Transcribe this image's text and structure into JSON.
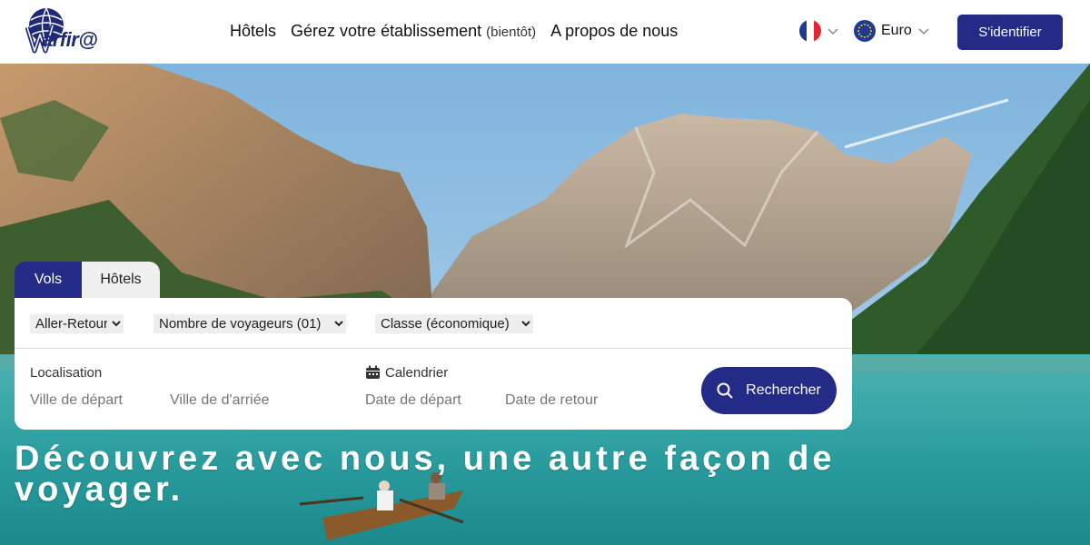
{
  "header": {
    "logo_text": "arfir@",
    "nav": {
      "hotels": "Hôtels",
      "manage": "Gérez votre établissement",
      "manage_soon": "(bientôt)",
      "about": "A propos de nous"
    },
    "currency": "Euro",
    "signin_label": "S'identifier"
  },
  "search": {
    "tabs": [
      {
        "label": "Vols",
        "active": true
      },
      {
        "label": "Hôtels",
        "active": false
      }
    ],
    "trip_type": {
      "selected": "Aller-Retour"
    },
    "travelers": {
      "selected": "Nombre de voyageurs (01)"
    },
    "class": {
      "selected": "Classe (économique)"
    },
    "location_label": "Localisation",
    "departure_city_placeholder": "Ville de départ",
    "arrival_city_placeholder": "Ville de d'arriée",
    "calendar_label": "Calendrier",
    "departure_date_placeholder": "Date de départ",
    "return_date_placeholder": "Date de retour",
    "submit_label": "Rechercher"
  },
  "hero": {
    "headline": "Découvrez avec nous, une autre façon de voyager."
  },
  "colors": {
    "brand": "#232b87"
  },
  "icons": [
    "globe-logo-icon",
    "france-flag-icon",
    "eu-flag-icon",
    "chevron-down-icon",
    "calendar-icon",
    "search-icon"
  ]
}
